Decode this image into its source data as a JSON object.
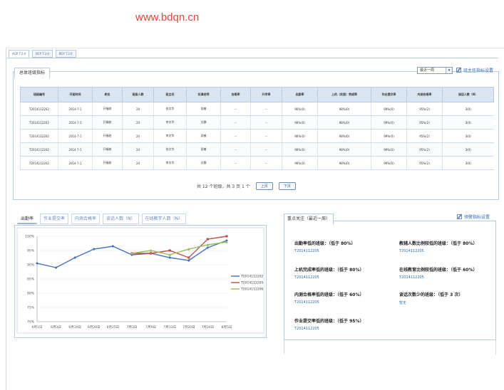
{
  "site": {
    "url": "www.bdqn.cn"
  },
  "top_tabs": [
    "AGP T.2.0",
    "BCP T.3.0",
    "BCP T.3.0"
  ],
  "main_panel": {
    "title": "总体班级指标",
    "select_value": "最近一周",
    "settings_link": "班主任指标设置"
  },
  "table": {
    "columns": [
      "班级编号",
      "开班时间",
      "校名",
      "班级人数",
      "班主任",
      "任课老师",
      "合格率",
      "升学率",
      "出勤率",
      "上机（实验）完成率",
      "作业提交率",
      "内测合格率",
      "谈话人数（N）"
    ],
    "rows": [
      [
        "T2014112202",
        "2014-7-1",
        "开福校",
        "24",
        "张文华",
        "吴敏",
        "--",
        "--",
        "96%(0)",
        "98%(0)",
        "99%(0)",
        "95%(2)",
        "3(0)"
      ],
      [
        "T2014112202",
        "2014-7-1",
        "开福校",
        "24",
        "李文华",
        "文静",
        "--",
        "--",
        "96%(0)",
        "98%(0)",
        "99%(0)",
        "95%(2)",
        "3(0)"
      ],
      [
        "T2014112202",
        "2014-7-1",
        "开福校",
        "24",
        "李文华",
        "吴敏",
        "--",
        "--",
        "96%(0)",
        "98%(0)",
        "99%(0)",
        "95%(2)",
        "3(0)"
      ],
      [
        "T2014112202",
        "2014-7-1",
        "开福校",
        "24",
        "张文华",
        "吴敏",
        "--",
        "--",
        "96%(0)",
        "98%(0)",
        "99%(0)",
        "95%(2)",
        "3(0)"
      ],
      [
        "T2014112202",
        "2014-7-1",
        "开福校",
        "24",
        "李文华",
        "文静",
        "--",
        "--",
        "96%(0)",
        "98%(0)",
        "99%(0)",
        "95%(2)",
        "3(0)"
      ]
    ]
  },
  "pager": {
    "summary": "共 12 个班级，共 3 页 1 个",
    "prev": "上页",
    "next": "下页"
  },
  "chart_tabs": [
    "出勤率",
    "作业提交率",
    "内测合格率",
    "谈话人数（N）",
    "在线教学人数（N）"
  ],
  "chart_data": {
    "type": "line",
    "x": [
      "6月1日",
      "6月3日",
      "6月10日",
      "6月20日",
      "6月25日",
      "7月3日",
      "7月9日",
      "7月13日",
      "7月20日",
      "7月24日",
      "8月5日"
    ],
    "ylim": [
      70,
      100
    ],
    "yticks": [
      "70%",
      "75%",
      "80%",
      "85%",
      "90%",
      "95%",
      "100%"
    ],
    "legend": "right",
    "series": [
      {
        "name": "T2014112202",
        "color": "#4472c4",
        "values": [
          90.5,
          89.0,
          92.5,
          95.5,
          96.5,
          93.5,
          94.0,
          92.5,
          91.5,
          96.0,
          98.5
        ]
      },
      {
        "name": "T2014112205",
        "color": "#c0504d",
        "values": [
          null,
          null,
          null,
          null,
          null,
          94.0,
          94.0,
          95.0,
          92.5,
          99.0,
          100.0
        ]
      },
      {
        "name": "T2014112206",
        "color": "#9bbb59",
        "values": [
          null,
          null,
          null,
          null,
          null,
          94.0,
          95.0,
          93.5,
          95.5,
          97.0,
          98.0
        ]
      }
    ]
  },
  "alert_panel": {
    "title": "重点关注（最近一周）",
    "settings_link": "预警指标设置",
    "items": [
      {
        "label": "出勤率低的班级：（低于 80%）",
        "value": "T2014112205"
      },
      {
        "label": "教辅人数比例较低的班级：（低于 80%）",
        "value": "T2014112205"
      },
      {
        "label": "上机完成率低的班级：（低于 80%）",
        "value": "T2014112205"
      },
      {
        "label": "在线教育比例较低的班级：（低于 60%）",
        "value": "T2014112205"
      },
      {
        "label": "内测合格率低的班级：（低于 60%）",
        "value": "T2014112205"
      },
      {
        "label": "谈话次数少的班级：（低于 3 次）",
        "value": "暂无"
      },
      {
        "label": "作业提交率低的班级：（低于 95%）",
        "value": "T2014112205"
      }
    ]
  }
}
